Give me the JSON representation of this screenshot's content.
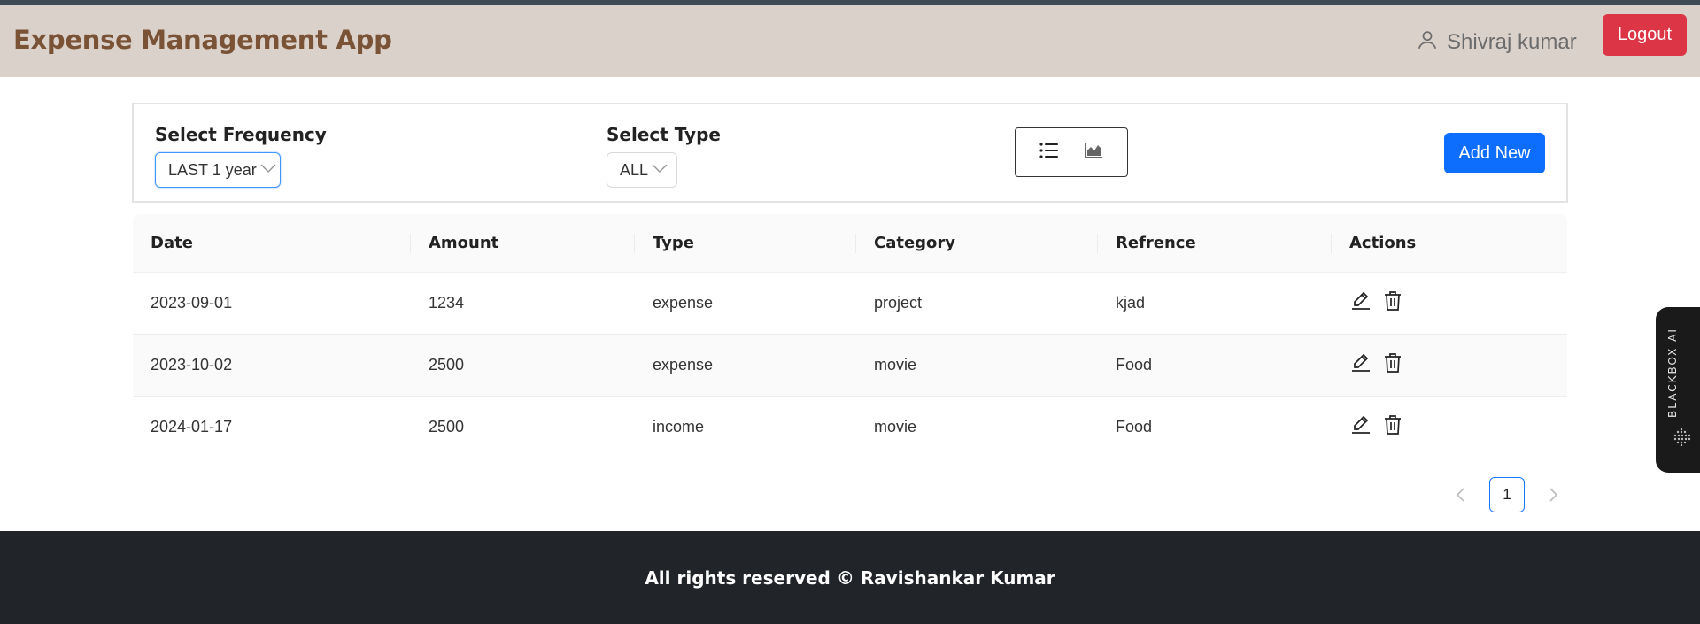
{
  "app": {
    "title": "Expense Management App"
  },
  "header": {
    "user_name": "Shivraj kumar",
    "logout_label": "Logout"
  },
  "filters": {
    "frequency_label": "Select Frequency",
    "frequency_value": "LAST 1 year",
    "type_label": "Select Type",
    "type_value": "ALL",
    "add_new_label": "Add New",
    "view_icons": [
      "list-icon",
      "area-chart-icon"
    ]
  },
  "table": {
    "columns": [
      "Date",
      "Amount",
      "Type",
      "Category",
      "Refrence",
      "Actions"
    ],
    "rows": [
      {
        "date": "2023-09-01",
        "amount": "1234",
        "type": "expense",
        "category": "project",
        "reference": "kjad"
      },
      {
        "date": "2023-10-02",
        "amount": "2500",
        "type": "expense",
        "category": "movie",
        "reference": "Food"
      },
      {
        "date": "2024-01-17",
        "amount": "2500",
        "type": "income",
        "category": "movie",
        "reference": "Food"
      }
    ],
    "action_icons": [
      "edit-icon",
      "delete-icon"
    ]
  },
  "pagination": {
    "current_page": "1"
  },
  "widget": {
    "label": "BLACKBOX AI"
  },
  "footer": {
    "text": "All rights reserved © Ravishankar Kumar"
  },
  "colors": {
    "navbar_bg": "#dbd1cb",
    "brand_text": "#7a5236",
    "logout_bg": "#dc3545",
    "primary": "#0d6efd",
    "footer_bg": "#212529"
  }
}
